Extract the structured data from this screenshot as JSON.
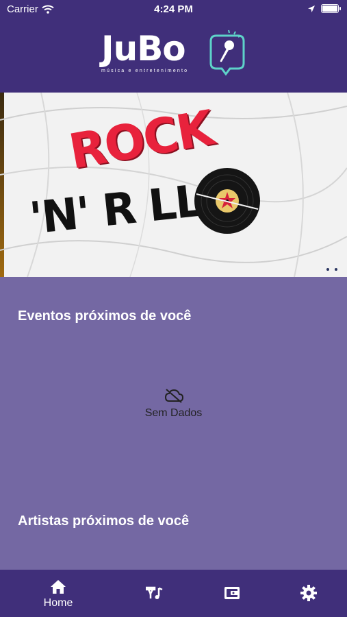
{
  "status_bar": {
    "carrier": "Carrier",
    "time": "4:24 PM",
    "battery_level": 1.0
  },
  "logo": {
    "name": "JuBo",
    "tagline": "música e entretenimento"
  },
  "banner": {
    "title_line1": "ROCK",
    "title_line2": "'N' R LL",
    "pages": 2
  },
  "sections": {
    "events_title": "Eventos próximos de você",
    "empty_label": "Sem Dados",
    "artists_title": "Artistas próximos de você"
  },
  "tabs": [
    {
      "label": "Home",
      "icon": "home-icon"
    },
    {
      "label": "",
      "icon": "music-playlist-icon"
    },
    {
      "label": "",
      "icon": "wallet-icon"
    },
    {
      "label": "",
      "icon": "gear-icon"
    }
  ],
  "colors": {
    "header": "#402f7a",
    "content": "#7468a3",
    "accent": "#5ed3c9",
    "rock_red": "#e8223c"
  }
}
